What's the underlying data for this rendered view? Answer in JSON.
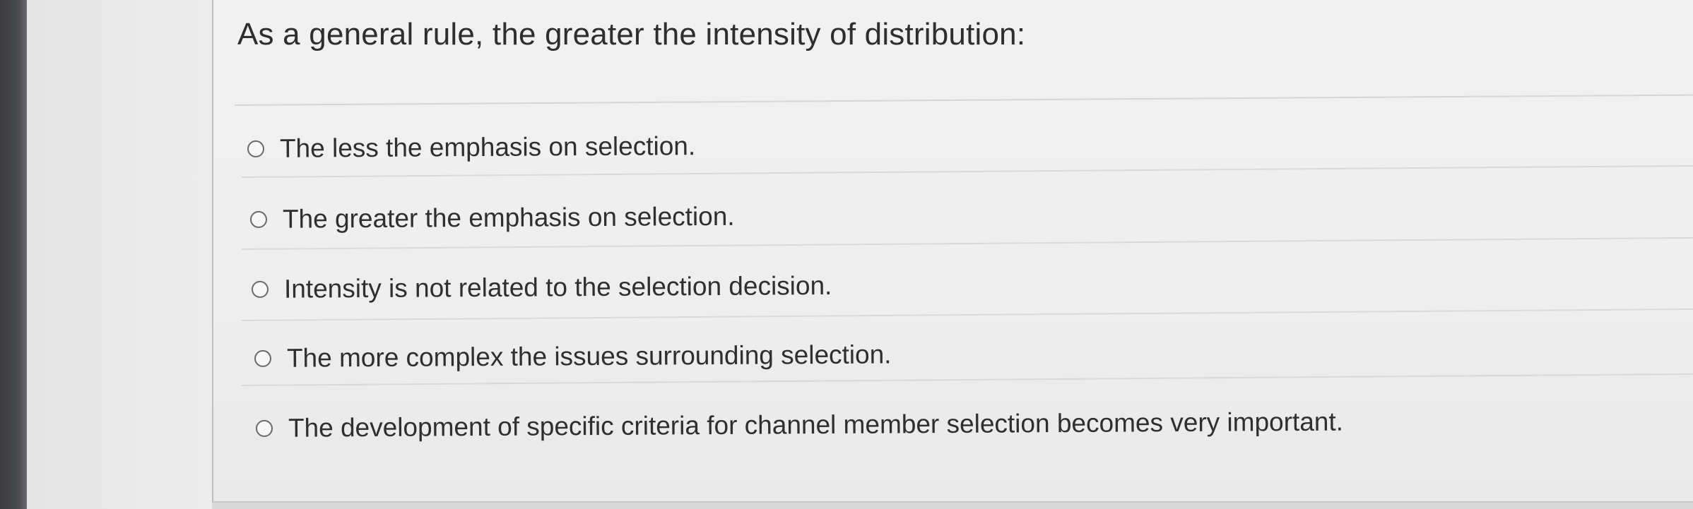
{
  "question": {
    "stem": "As a general rule, the greater the intensity of distribution:"
  },
  "answers": [
    {
      "label": "The less the emphasis on selection.",
      "selected": false
    },
    {
      "label": "The greater the emphasis on selection.",
      "selected": false
    },
    {
      "label": "Intensity is not related to the selection decision.",
      "selected": false
    },
    {
      "label": "The more complex the issues surrounding selection.",
      "selected": false
    },
    {
      "label": "The development of specific criteria for channel member selection becomes very important.",
      "selected": false
    }
  ]
}
